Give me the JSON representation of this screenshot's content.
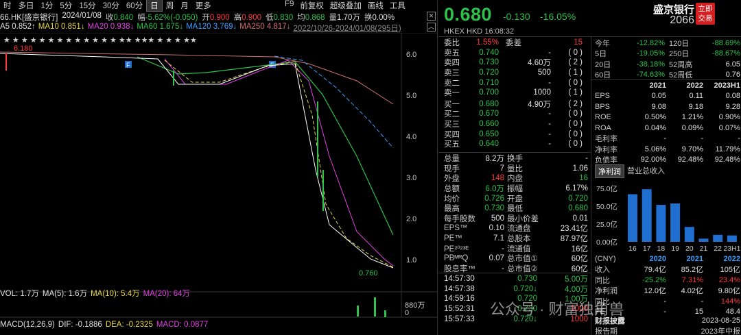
{
  "periods": [
    "时",
    "多日",
    "1分",
    "5分",
    "15分",
    "30分",
    "60分",
    "日",
    "周",
    "月",
    "更多"
  ],
  "selected_period": "日",
  "tools": [
    "F9",
    "前复权",
    "超级叠加",
    "画线",
    "工具"
  ],
  "info": {
    "code": "66.HK[盛京银行]",
    "date": "2024/01/08",
    "close_label": "收",
    "close": "0.840",
    "amp_label": "幅",
    "amp": "-5.62%(-0.050)",
    "open_label": "开",
    "open": "0.900",
    "high_label": "高",
    "high": "0.900",
    "low_label": "低",
    "low": "0.830",
    "avg_label": "均",
    "avg": "0.868",
    "vol_label": "量",
    "vol": "1.70万",
    "turn_label": "换",
    "turn": "0.00%"
  },
  "ma": {
    "ma5": "A5 0.852↑",
    "ma10": "MA10 0.851↓",
    "ma20": "MA20 0.938↓",
    "ma60": "MA60 1.675↓",
    "ma120": "MA120 3.769↓",
    "ma250": "MA250 4.817↓",
    "range": "2022/10/26-2024/01/08(295日)"
  },
  "price_axis": [
    "6.0",
    "5.0",
    "4.0",
    "3.0",
    "2.0",
    "1.0"
  ],
  "chart_labels": {
    "high_mark": "6.180",
    "low_mark": "0.760",
    "f_mark": "F"
  },
  "vol_row": {
    "vol": "VOL: 1.7万",
    "ma5": "MA(5): 1.6万",
    "ma10": "MA(10): 5.4万",
    "ma20": "MA(20): 64万",
    "axis_top": "880万",
    "axis_zero": "0"
  },
  "macd_row": {
    "label": "MACD(12,26,9)",
    "dif": "DIF: -0.1886",
    "dea": "DEA: -0.2325",
    "macd": "MACD: 0.0877"
  },
  "quote": {
    "price": "0.680",
    "change": "-0.130",
    "pct": "-16.05%",
    "name": "盛京银行",
    "code": "2066",
    "trade_btn": "立即交易",
    "exchange": "HKEX",
    "currency": "HKD",
    "time": "16:08:32"
  },
  "order_book": {
    "ratio": {
      "label": "委比",
      "value": "1.55%",
      "diff_label": "委差",
      "diff": "15"
    },
    "asks": [
      {
        "label": "卖五",
        "price": "0.740",
        "vol": "-",
        "cnt": "0"
      },
      {
        "label": "卖四",
        "price": "0.730",
        "vol": "4.60万",
        "cnt": "2"
      },
      {
        "label": "卖三",
        "price": "0.720",
        "vol": "500",
        "cnt": "1"
      },
      {
        "label": "卖二",
        "price": "0.710",
        "vol": "-",
        "cnt": "0"
      },
      {
        "label": "卖一",
        "price": "0.700",
        "vol": "1000",
        "cnt": "1"
      }
    ],
    "bids": [
      {
        "label": "买一",
        "price": "0.680",
        "vol": "4.90万",
        "cnt": "2"
      },
      {
        "label": "买二",
        "price": "0.670",
        "vol": "-",
        "cnt": "0"
      },
      {
        "label": "买三",
        "price": "0.660",
        "vol": "-",
        "cnt": "0"
      },
      {
        "label": "买四",
        "price": "0.650",
        "vol": "-",
        "cnt": "0"
      },
      {
        "label": "买五",
        "price": "0.640",
        "vol": "-",
        "cnt": "0"
      }
    ]
  },
  "stats": [
    {
      "l1": "总量",
      "v1": "8.2万",
      "l2": "换手",
      "v2": "-"
    },
    {
      "l1": "现手",
      "v1": "7",
      "l2": "量比",
      "v2": "1.06"
    },
    {
      "l1": "外盘",
      "v1": "148",
      "l2": "内盘",
      "v2": "16"
    },
    {
      "l1": "总额",
      "v1": "6.0万",
      "l2": "振幅",
      "v2": "6.17%"
    },
    {
      "l1": "均价",
      "v1": "0.726",
      "l2": "开盘",
      "v2": "0.720"
    },
    {
      "l1": "最高",
      "v1": "0.730",
      "l2": "最低",
      "v2": "0.680"
    },
    {
      "l1": "每手股数",
      "v1": "500",
      "l2": "最小价差",
      "v2": "0.01"
    },
    {
      "l1": "EPS™",
      "v1": "0.10",
      "l2": "流通盘",
      "v2": "23.41亿"
    },
    {
      "l1": "PE™",
      "v1": "7.1",
      "l2": "总股本",
      "v2": "87.97亿"
    },
    {
      "l1": "PE²⁰²³ᴱ",
      "v1": "-",
      "l2": "流通值",
      "v2": "16亿"
    },
    {
      "l1": "PBᴹᴿQ",
      "v1": "0.07",
      "l2": "总市值①",
      "v2": "60亿"
    },
    {
      "l1": "股息率™",
      "v1": "-",
      "l2": "总市值②",
      "v2": "60亿"
    }
  ],
  "ticks": [
    {
      "time": "14:57:30",
      "price": "0.730",
      "vol": "5.00万"
    },
    {
      "time": "14:57:38",
      "price": "0.720↓",
      "vol": "4.00万"
    },
    {
      "time": "14:59:16",
      "price": "0.720",
      "vol": "1.00万"
    },
    {
      "time": "15:52:31",
      "price": "0.730",
      "vol": "1000"
    },
    {
      "time": "15:57:33",
      "price": "0.720↓",
      "vol": "1000"
    }
  ],
  "perf": [
    {
      "l1": "今年",
      "v1": "-12.82%",
      "l2": "120日",
      "v2": "-88.69%"
    },
    {
      "l1": "5日",
      "v1": "-19.05%",
      "l2": "250日",
      "v2": "-88.67%"
    },
    {
      "l1": "20日",
      "v1": "-38.18%",
      "l2": "52周高",
      "v2": "6.05"
    },
    {
      "l1": "60日",
      "v1": "-74.63%",
      "l2": "52周低",
      "v2": "0.76"
    }
  ],
  "fin_years": [
    "2021",
    "2022",
    "2023H1"
  ],
  "fin_rows": [
    {
      "label": "EPS",
      "v": [
        "0.05",
        "0.11",
        "0.08"
      ]
    },
    {
      "label": "BPS",
      "v": [
        "9.08",
        "9.18",
        "9.28"
      ]
    },
    {
      "label": "ROE",
      "v": [
        "0.50%",
        "1.21%",
        "0.90%"
      ]
    },
    {
      "label": "ROA",
      "v": [
        "0.04%",
        "0.09%",
        "0.07%"
      ]
    },
    {
      "label": "毛利率",
      "v": [
        "-",
        "-",
        "-"
      ]
    },
    {
      "label": "净利率",
      "v": [
        "5.06%",
        "9.70%",
        "11.79%"
      ]
    },
    {
      "label": "负债率",
      "v": [
        "92.00%",
        "92.48%",
        "92.48%"
      ]
    }
  ],
  "tabs": [
    "净利润",
    "营业总收入"
  ],
  "chart_data": {
    "type": "bar",
    "categories": [
      "16",
      "17",
      "18",
      "19",
      "20",
      "21",
      "22",
      "23H1"
    ],
    "values": [
      67,
      74,
      52,
      54,
      21,
      4.5,
      9.8,
      9
    ],
    "yticks": [
      "75.0亿",
      "50.0亿",
      "25.0亿",
      "0.00亿"
    ],
    "ylim": [
      0,
      80
    ]
  },
  "fin_table": {
    "unit": "(CNY)",
    "years": [
      "2020",
      "2021",
      "2022"
    ],
    "rows": [
      {
        "label": "收入",
        "v": [
          "79.4亿",
          "85.2亿",
          "105亿"
        ]
      },
      {
        "label": "同比",
        "v": [
          "-25.2%",
          "7.31%",
          "23.4%"
        ]
      },
      {
        "label": "净利润",
        "v": [
          "12.0亿",
          "4.02亿",
          "9.80亿"
        ]
      },
      {
        "label": "同比",
        "v": [
          "-",
          "-",
          "144%"
        ]
      },
      {
        "label": "PE",
        "v": [
          "-",
          "15",
          "48.4"
        ]
      }
    ]
  },
  "report": {
    "label": "财报披露",
    "date": "2023-08-25",
    "label2": "报告期",
    "period": "2023年中报"
  },
  "watermark": "公众号 · 财富独角兽",
  "colors": {
    "up": "#ff3b3b",
    "down": "#2ec24a",
    "bar": "#1f6fd1",
    "trade": "#d31f1f"
  }
}
